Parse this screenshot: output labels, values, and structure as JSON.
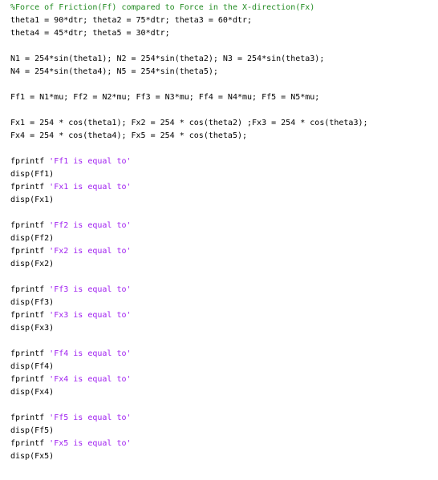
{
  "colors": {
    "background": "#ffffff",
    "text": "#000000",
    "comment": "#228b22",
    "string": "#a020f0"
  },
  "code_lines": [
    [
      {
        "t": "%Force of Friction(Ff) compared to Force in the X-direction(Fx)",
        "c": "comment"
      }
    ],
    [
      {
        "t": "theta1 = 90*dtr; theta2 = 75*dtr; theta3 = 60*dtr;",
        "c": "plain"
      }
    ],
    [
      {
        "t": "theta4 = 45*dtr; theta5 = 30*dtr;",
        "c": "plain"
      }
    ],
    [],
    [
      {
        "t": "N1 = 254*sin(theta1); N2 = 254*sin(theta2); N3 = 254*sin(theta3);",
        "c": "plain"
      }
    ],
    [
      {
        "t": "N4 = 254*sin(theta4); N5 = 254*sin(theta5);",
        "c": "plain"
      }
    ],
    [],
    [
      {
        "t": "Ff1 = N1*mu; Ff2 = N2*mu; Ff3 = N3*mu; Ff4 = N4*mu; Ff5 = N5*mu;",
        "c": "plain"
      }
    ],
    [],
    [
      {
        "t": "Fx1 = 254 * cos(theta1); Fx2 = 254 * cos(theta2) ;Fx3 = 254 * cos(theta3);",
        "c": "plain"
      }
    ],
    [
      {
        "t": "Fx4 = 254 * cos(theta4); Fx5 = 254 * cos(theta5);",
        "c": "plain"
      }
    ],
    [],
    [
      {
        "t": "fprintf ",
        "c": "plain"
      },
      {
        "t": "'Ff1 is equal to'",
        "c": "string"
      }
    ],
    [
      {
        "t": "disp(Ff1)",
        "c": "plain"
      }
    ],
    [
      {
        "t": "fprintf ",
        "c": "plain"
      },
      {
        "t": "'Fx1 is equal to'",
        "c": "string"
      }
    ],
    [
      {
        "t": "disp(Fx1)",
        "c": "plain"
      }
    ],
    [],
    [
      {
        "t": "fprintf ",
        "c": "plain"
      },
      {
        "t": "'Ff2 is equal to'",
        "c": "string"
      }
    ],
    [
      {
        "t": "disp(Ff2)",
        "c": "plain"
      }
    ],
    [
      {
        "t": "fprintf ",
        "c": "plain"
      },
      {
        "t": "'Fx2 is equal to'",
        "c": "string"
      }
    ],
    [
      {
        "t": "disp(Fx2)",
        "c": "plain"
      }
    ],
    [],
    [
      {
        "t": "fprintf ",
        "c": "plain"
      },
      {
        "t": "'Ff3 is equal to'",
        "c": "string"
      }
    ],
    [
      {
        "t": "disp(Ff3)",
        "c": "plain"
      }
    ],
    [
      {
        "t": "fprintf ",
        "c": "plain"
      },
      {
        "t": "'Fx3 is equal to'",
        "c": "string"
      }
    ],
    [
      {
        "t": "disp(Fx3)",
        "c": "plain"
      }
    ],
    [],
    [
      {
        "t": "fprintf ",
        "c": "plain"
      },
      {
        "t": "'Ff4 is equal to'",
        "c": "string"
      }
    ],
    [
      {
        "t": "disp(Ff4)",
        "c": "plain"
      }
    ],
    [
      {
        "t": "fprintf ",
        "c": "plain"
      },
      {
        "t": "'Fx4 is equal to'",
        "c": "string"
      }
    ],
    [
      {
        "t": "disp(Fx4)",
        "c": "plain"
      }
    ],
    [],
    [
      {
        "t": "fprintf ",
        "c": "plain"
      },
      {
        "t": "'Ff5 is equal to'",
        "c": "string"
      }
    ],
    [
      {
        "t": "disp(Ff5)",
        "c": "plain"
      }
    ],
    [
      {
        "t": "fprintf ",
        "c": "plain"
      },
      {
        "t": "'Fx5 is equal to'",
        "c": "string"
      }
    ],
    [
      {
        "t": "disp(Fx5)",
        "c": "plain"
      }
    ]
  ]
}
